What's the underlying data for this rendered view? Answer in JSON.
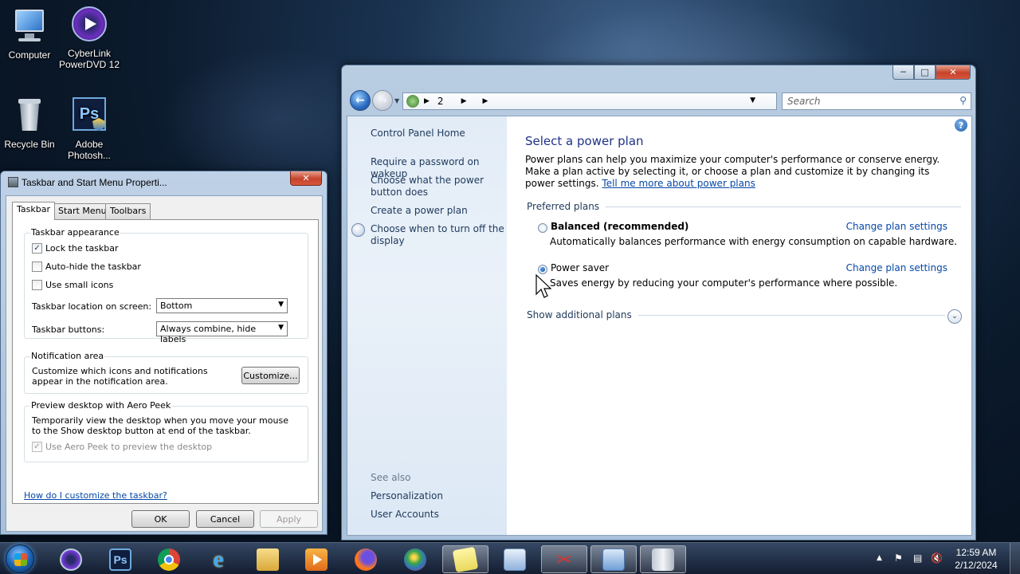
{
  "desktop": {
    "icons": [
      {
        "label": "Computer"
      },
      {
        "label": "CyberLink PowerDVD 12"
      },
      {
        "label": "Recycle Bin"
      },
      {
        "label": "Adobe Photosh..."
      }
    ]
  },
  "control_panel": {
    "address": {
      "segment": "2"
    },
    "search_placeholder": "Search",
    "left": {
      "home": "Control Panel Home",
      "links": [
        "Require a password on wakeup",
        "Choose what the power button does",
        "Create a power plan",
        "Choose when to turn off the display"
      ],
      "see_also_label": "See also",
      "see_also": [
        "Personalization",
        "User Accounts"
      ]
    },
    "main": {
      "title": "Select a power plan",
      "description": "Power plans can help you maximize your computer's performance or conserve energy. Make a plan active by selecting it, or choose a plan and customize it by changing its power settings.",
      "tell_me_link": "Tell me more about power plans",
      "preferred_header": "Preferred plans",
      "plans": [
        {
          "name": "Balanced (recommended)",
          "description": "Automatically balances performance with energy consumption on capable hardware.",
          "link": "Change plan settings",
          "selected": false
        },
        {
          "name": "Power saver",
          "description": "Saves energy by reducing your computer's performance where possible.",
          "link": "Change plan settings",
          "selected": true
        }
      ],
      "additional_header": "Show additional plans"
    }
  },
  "taskbar_dialog": {
    "title": "Taskbar and Start Menu Properti...",
    "tabs": [
      "Taskbar",
      "Start Menu",
      "Toolbars"
    ],
    "appearance": {
      "legend": "Taskbar appearance",
      "lock": "Lock the taskbar",
      "autohide": "Auto-hide the taskbar",
      "small_icons": "Use small icons",
      "location_label": "Taskbar location on screen:",
      "location_value": "Bottom",
      "buttons_label": "Taskbar buttons:",
      "buttons_value": "Always combine, hide labels"
    },
    "notification": {
      "legend": "Notification area",
      "text": "Customize which icons and notifications appear in the notification area.",
      "customize": "Customize..."
    },
    "aero": {
      "legend": "Preview desktop with Aero Peek",
      "text": "Temporarily view the desktop when you move your mouse to the Show desktop button at end of the taskbar.",
      "checkbox": "Use Aero Peek to preview the desktop"
    },
    "help_link": "How do I customize the taskbar?",
    "ok": "OK",
    "cancel": "Cancel",
    "apply": "Apply"
  },
  "taskbar": {
    "time": "12:59 AM",
    "date": "2/12/2024"
  },
  "colors": {
    "link": "#0648a8",
    "title_blue": "#1e3287",
    "nav_pane": "#e2ecf7"
  }
}
